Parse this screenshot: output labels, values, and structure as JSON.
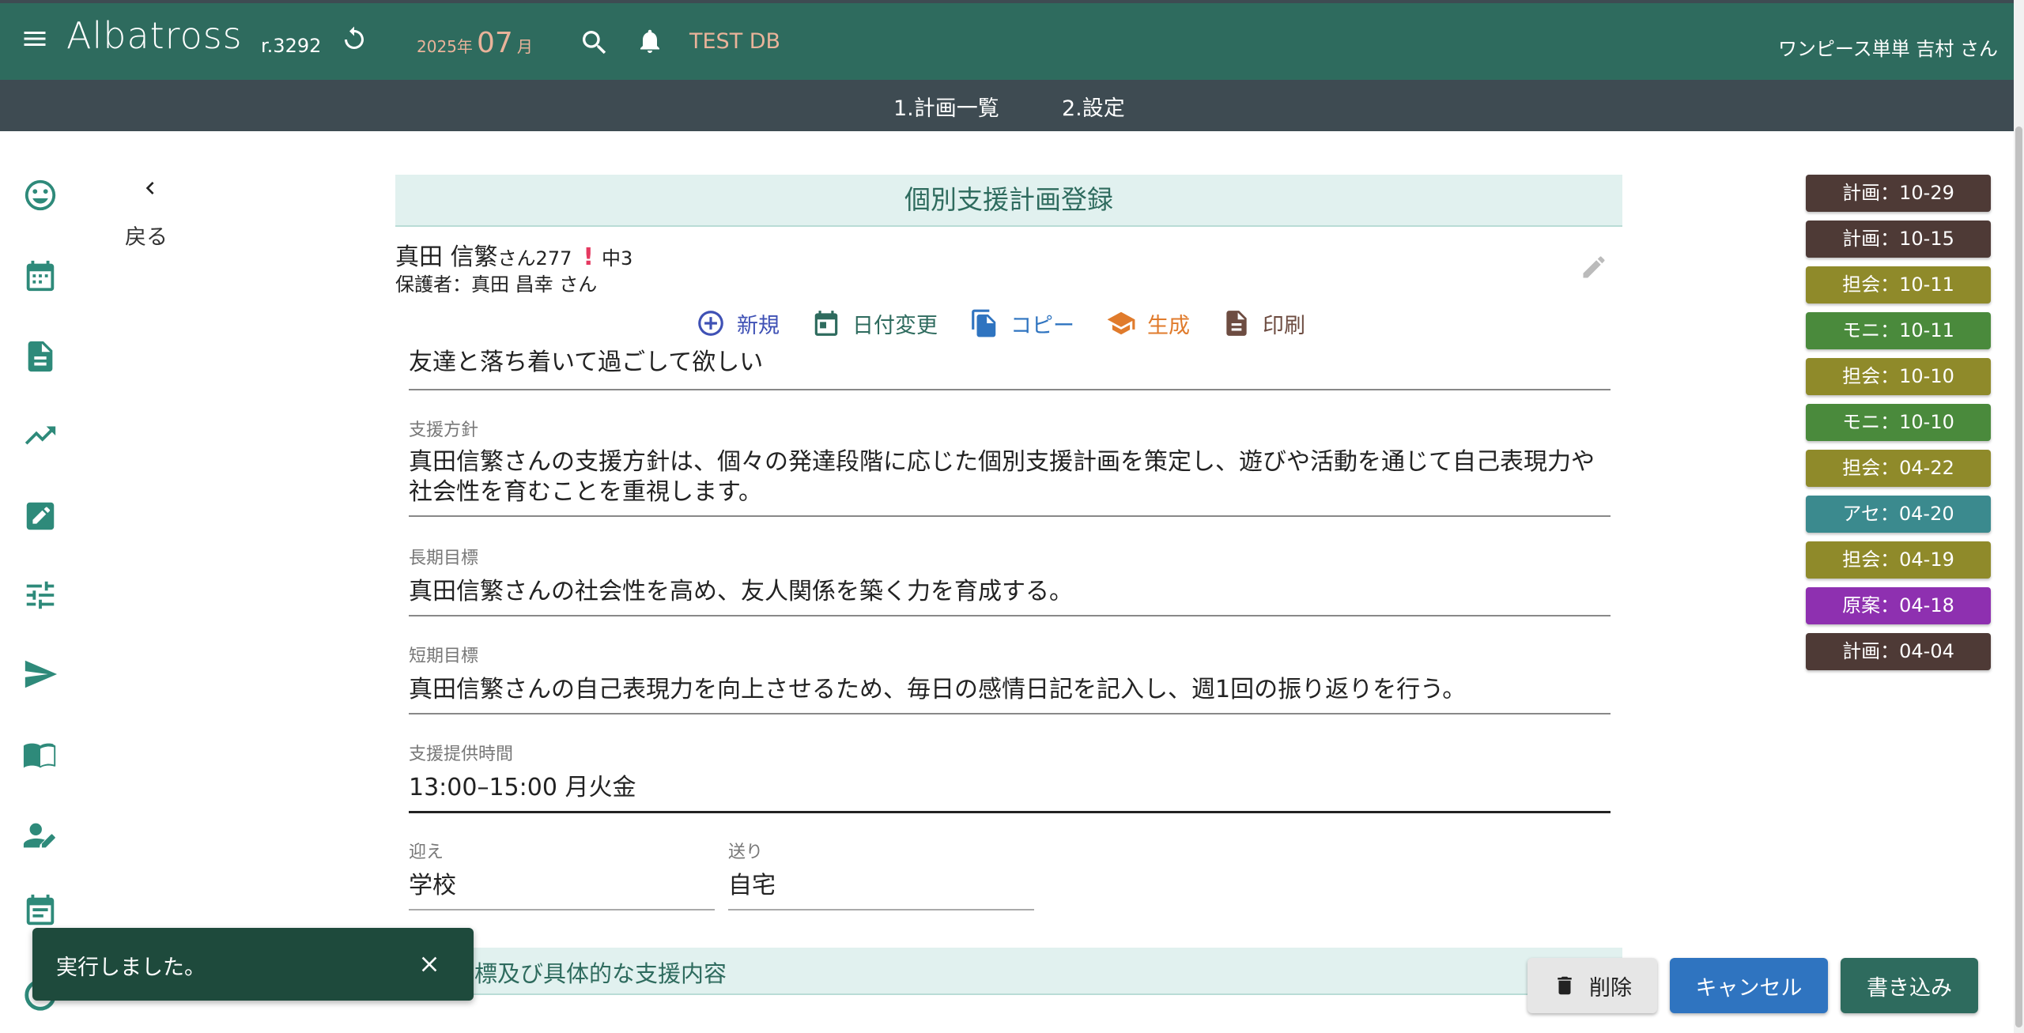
{
  "header": {
    "brand": "Albatross",
    "revision": "r.3292",
    "year": "2025年",
    "month": "07",
    "month_unit": "月",
    "db_label": "TEST DB",
    "user": "ワンピース単単 吉村 さん"
  },
  "subnav": {
    "tabs": [
      {
        "label": "1.計画一覧"
      },
      {
        "label": "2.設定"
      }
    ]
  },
  "back": {
    "label": "戻る"
  },
  "page": {
    "title": "個別支援計画登録"
  },
  "person": {
    "name": "真田 信繁",
    "suffix": "さん277",
    "alert": "!",
    "grade": "中3",
    "guardian": "保護者：真田 昌幸 さん"
  },
  "actions": {
    "new": "新規",
    "date_change": "日付変更",
    "copy": "コピー",
    "generate": "生成",
    "print": "印刷"
  },
  "fields": {
    "wish": {
      "value": "友達と落ち着いて過ごして欲しい"
    },
    "policy": {
      "label": "支援方針",
      "value": "真田信繁さんの支援方針は、個々の発達段階に応じた個別支援計画を策定し、遊びや活動を通じて自己表現力や社会性を育むことを重視します。"
    },
    "long_goal": {
      "label": "長期目標",
      "value": "真田信繁さんの社会性を高め、友人関係を築く力を育成する。"
    },
    "short_goal": {
      "label": "短期目標",
      "value": "真田信繁さんの自己表現力を向上させるため、毎日の感情日記を記入し、週1回の振り返りを行う。"
    },
    "time": {
      "label": "支援提供時間",
      "value": "13:00–15:00 月火金"
    },
    "pickup": {
      "label": "迎え",
      "value": "学校"
    },
    "dropoff": {
      "label": "送り",
      "value": "自宅"
    }
  },
  "section2": {
    "title": "標及び具体的な支援内容"
  },
  "history": [
    {
      "label": "計画：10-29",
      "color": "#4e3a36"
    },
    {
      "label": "計画：10-15",
      "color": "#4e3a36"
    },
    {
      "label": "担会：10-11",
      "color": "#8f8a2a"
    },
    {
      "label": "モニ：10-11",
      "color": "#4a8a3c"
    },
    {
      "label": "担会：10-10",
      "color": "#8f8a2a"
    },
    {
      "label": "モニ：10-10",
      "color": "#4a8a3c"
    },
    {
      "label": "担会：04-22",
      "color": "#8f8a2a"
    },
    {
      "label": "アセ：04-20",
      "color": "#3b8a8e"
    },
    {
      "label": "担会：04-19",
      "color": "#8f8a2a"
    },
    {
      "label": "原案：04-18",
      "color": "#8e30b0"
    },
    {
      "label": "計画：04-04",
      "color": "#4e3a36"
    }
  ],
  "snackbar": {
    "message": "実行しました。"
  },
  "buttons": {
    "delete": "削除",
    "cancel": "キャンセル",
    "save": "書き込み"
  },
  "colors": {
    "primary": "#2e6b5e",
    "subnav": "#3e4b52",
    "accent": "#e9b39a",
    "cancel": "#2f74c0"
  }
}
